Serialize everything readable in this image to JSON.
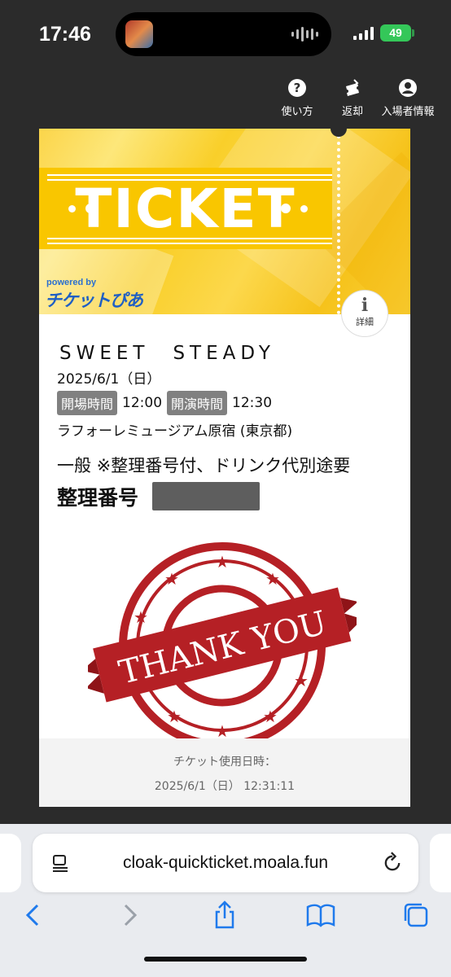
{
  "status_bar": {
    "time": "17:46",
    "battery": "49"
  },
  "header": {
    "nav": [
      {
        "label": "使い方",
        "icon": "help-circle-icon"
      },
      {
        "label": "返却",
        "icon": "ticket-return-icon"
      },
      {
        "label": "入場者情報",
        "icon": "user-circle-icon"
      }
    ]
  },
  "ticket": {
    "banner_title": "TICKET",
    "powered_by": "powered by",
    "brand": "チケットぴあ",
    "info_button_label": "詳細",
    "event_title": "SWEET　STEADY",
    "date": "2025/6/1（日）",
    "open_label": "開場時間",
    "open_time": "12:00",
    "start_label": "開演時間",
    "start_time": "12:30",
    "venue": "ラフォーレミュージアム原宿 (東京都)",
    "ticket_type": "一般 ※整理番号付、ドリンク代別途要",
    "number_label": "整理番号",
    "stamp_text": "THANK YOU",
    "usage_label": "チケット使用日時：",
    "usage_time": "2025/6/1（日） 12:31:11"
  },
  "browser": {
    "url": "cloak-quickticket.moala.fun",
    "toolbar": [
      "back-icon",
      "forward-icon",
      "share-icon",
      "bookmarks-icon",
      "tabs-icon"
    ]
  },
  "colors": {
    "accent_yellow": "#f9c600",
    "stamp_red": "#b52025",
    "tag_gray": "#808080",
    "link_blue": "#1f7aec"
  }
}
